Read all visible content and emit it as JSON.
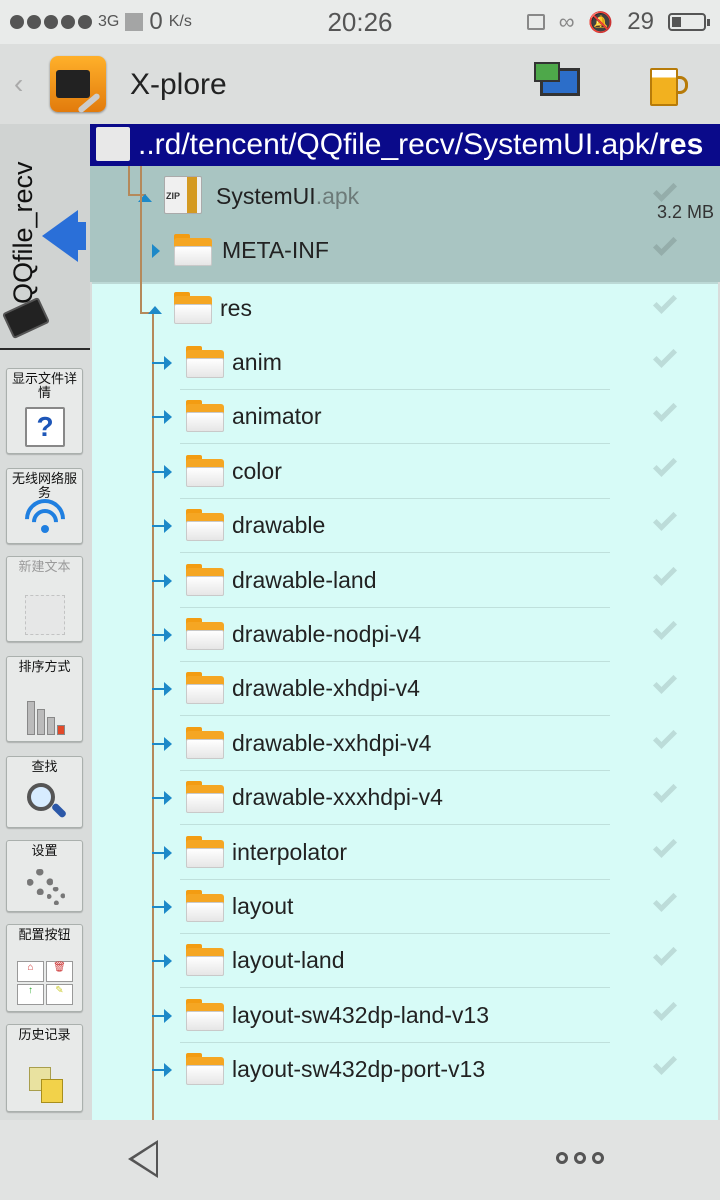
{
  "status_bar": {
    "network": "3G",
    "speed_value": "0",
    "speed_unit": "K/s",
    "time": "20:26",
    "battery_level": "29"
  },
  "app": {
    "title": "X-plore"
  },
  "left_panel": {
    "vertical_tab_label": "QQfile_recv",
    "tools": [
      {
        "label": "显示文件详情",
        "icon": "help-document-icon",
        "enabled": true
      },
      {
        "label": "无线网络服务",
        "icon": "wifi-icon",
        "enabled": true
      },
      {
        "label": "新建文本",
        "icon": "new-text-icon",
        "enabled": false
      },
      {
        "label": "排序方式",
        "icon": "sort-icon",
        "enabled": true
      },
      {
        "label": "查找",
        "icon": "search-icon",
        "enabled": true
      },
      {
        "label": "设置",
        "icon": "gear-icon",
        "enabled": true
      },
      {
        "label": "配置按钮",
        "icon": "configure-buttons-icon",
        "enabled": true
      },
      {
        "label": "历史记录",
        "icon": "history-icon",
        "enabled": true
      }
    ]
  },
  "path_bar": {
    "prefix": "..rd/tencent/QQfile_recv/SystemUI.apk/",
    "current": "res"
  },
  "archive": {
    "name": "SystemUI",
    "ext": ".apk",
    "size": "3.2 MB"
  },
  "upper_folders": [
    {
      "name": "META-INF"
    }
  ],
  "open_folder": {
    "name": "res"
  },
  "folders": [
    {
      "name": "anim"
    },
    {
      "name": "animator"
    },
    {
      "name": "color"
    },
    {
      "name": "drawable"
    },
    {
      "name": "drawable-land"
    },
    {
      "name": "drawable-nodpi-v4"
    },
    {
      "name": "drawable-xhdpi-v4"
    },
    {
      "name": "drawable-xxhdpi-v4"
    },
    {
      "name": "drawable-xxxhdpi-v4"
    },
    {
      "name": "interpolator"
    },
    {
      "name": "layout"
    },
    {
      "name": "layout-land"
    },
    {
      "name": "layout-sw432dp-land-v13"
    },
    {
      "name": "layout-sw432dp-port-v13"
    }
  ],
  "colors": {
    "path_bar_bg": "#0a0a8a",
    "list_bg": "#d7fbf7",
    "folder": "#f5a623",
    "accent_arrow": "#1d89c8"
  }
}
